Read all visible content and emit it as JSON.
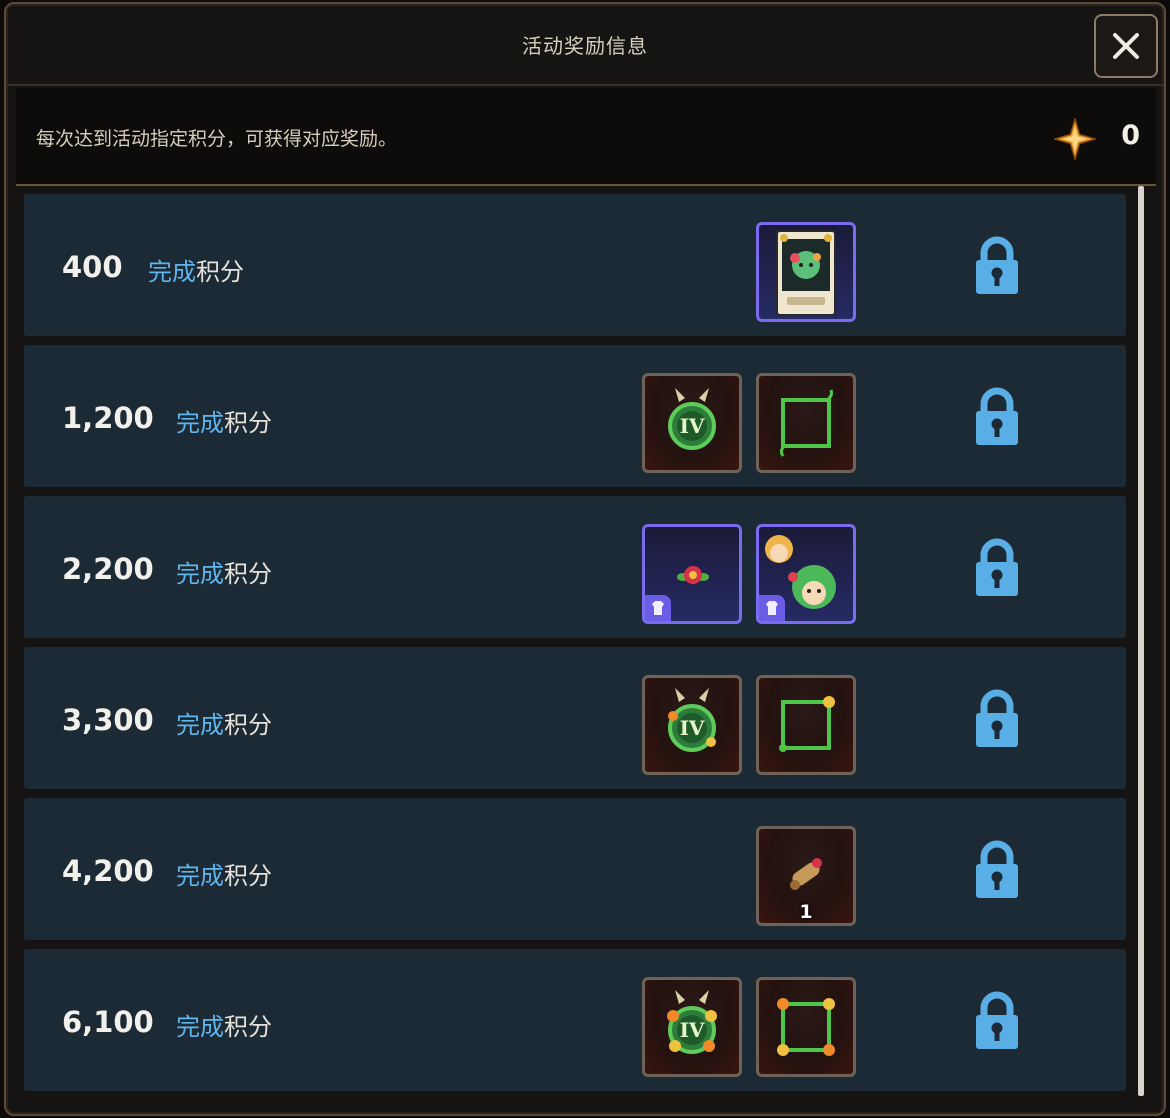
{
  "dialog": {
    "title": "活动奖励信息",
    "close_icon": "close-icon"
  },
  "info": {
    "description": "每次达到活动指定积分，可获得对应奖励。",
    "score_icon": "star-point-icon",
    "score": "0"
  },
  "complete_label": {
    "highlight": "完成",
    "rest": "积分"
  },
  "colors": {
    "accent_blue": "#5fb5ee",
    "row_bg": "#1c2a35",
    "purple_border": "#7a6bf0",
    "lock_blue": "#5aaee6"
  },
  "rows": [
    {
      "points": "400",
      "rewards": [
        {
          "icon": "illustration-card-icon",
          "rarity": "purple"
        }
      ],
      "status_icon": "lock-icon"
    },
    {
      "points": "1,200",
      "rewards": [
        {
          "icon": "vine-badge-iv-icon",
          "rarity": "normal"
        },
        {
          "icon": "vine-frame-icon",
          "rarity": "normal"
        }
      ],
      "status_icon": "lock-icon"
    },
    {
      "points": "2,200",
      "rewards": [
        {
          "icon": "flower-accessory-costume-icon",
          "rarity": "purple"
        },
        {
          "icon": "character-costume-icon",
          "rarity": "purple"
        }
      ],
      "status_icon": "lock-icon"
    },
    {
      "points": "3,300",
      "rewards": [
        {
          "icon": "flower-badge-iv-icon",
          "rarity": "normal"
        },
        {
          "icon": "flower-frame-icon",
          "rarity": "normal"
        }
      ],
      "status_icon": "lock-icon"
    },
    {
      "points": "4,200",
      "rewards": [
        {
          "icon": "scroll-icon",
          "rarity": "normal",
          "quantity": "1"
        }
      ],
      "status_icon": "lock-icon"
    },
    {
      "points": "6,100",
      "rewards": [
        {
          "icon": "bloom-badge-iv-icon",
          "rarity": "normal"
        },
        {
          "icon": "bloom-frame-icon",
          "rarity": "normal"
        }
      ],
      "status_icon": "lock-icon"
    }
  ]
}
